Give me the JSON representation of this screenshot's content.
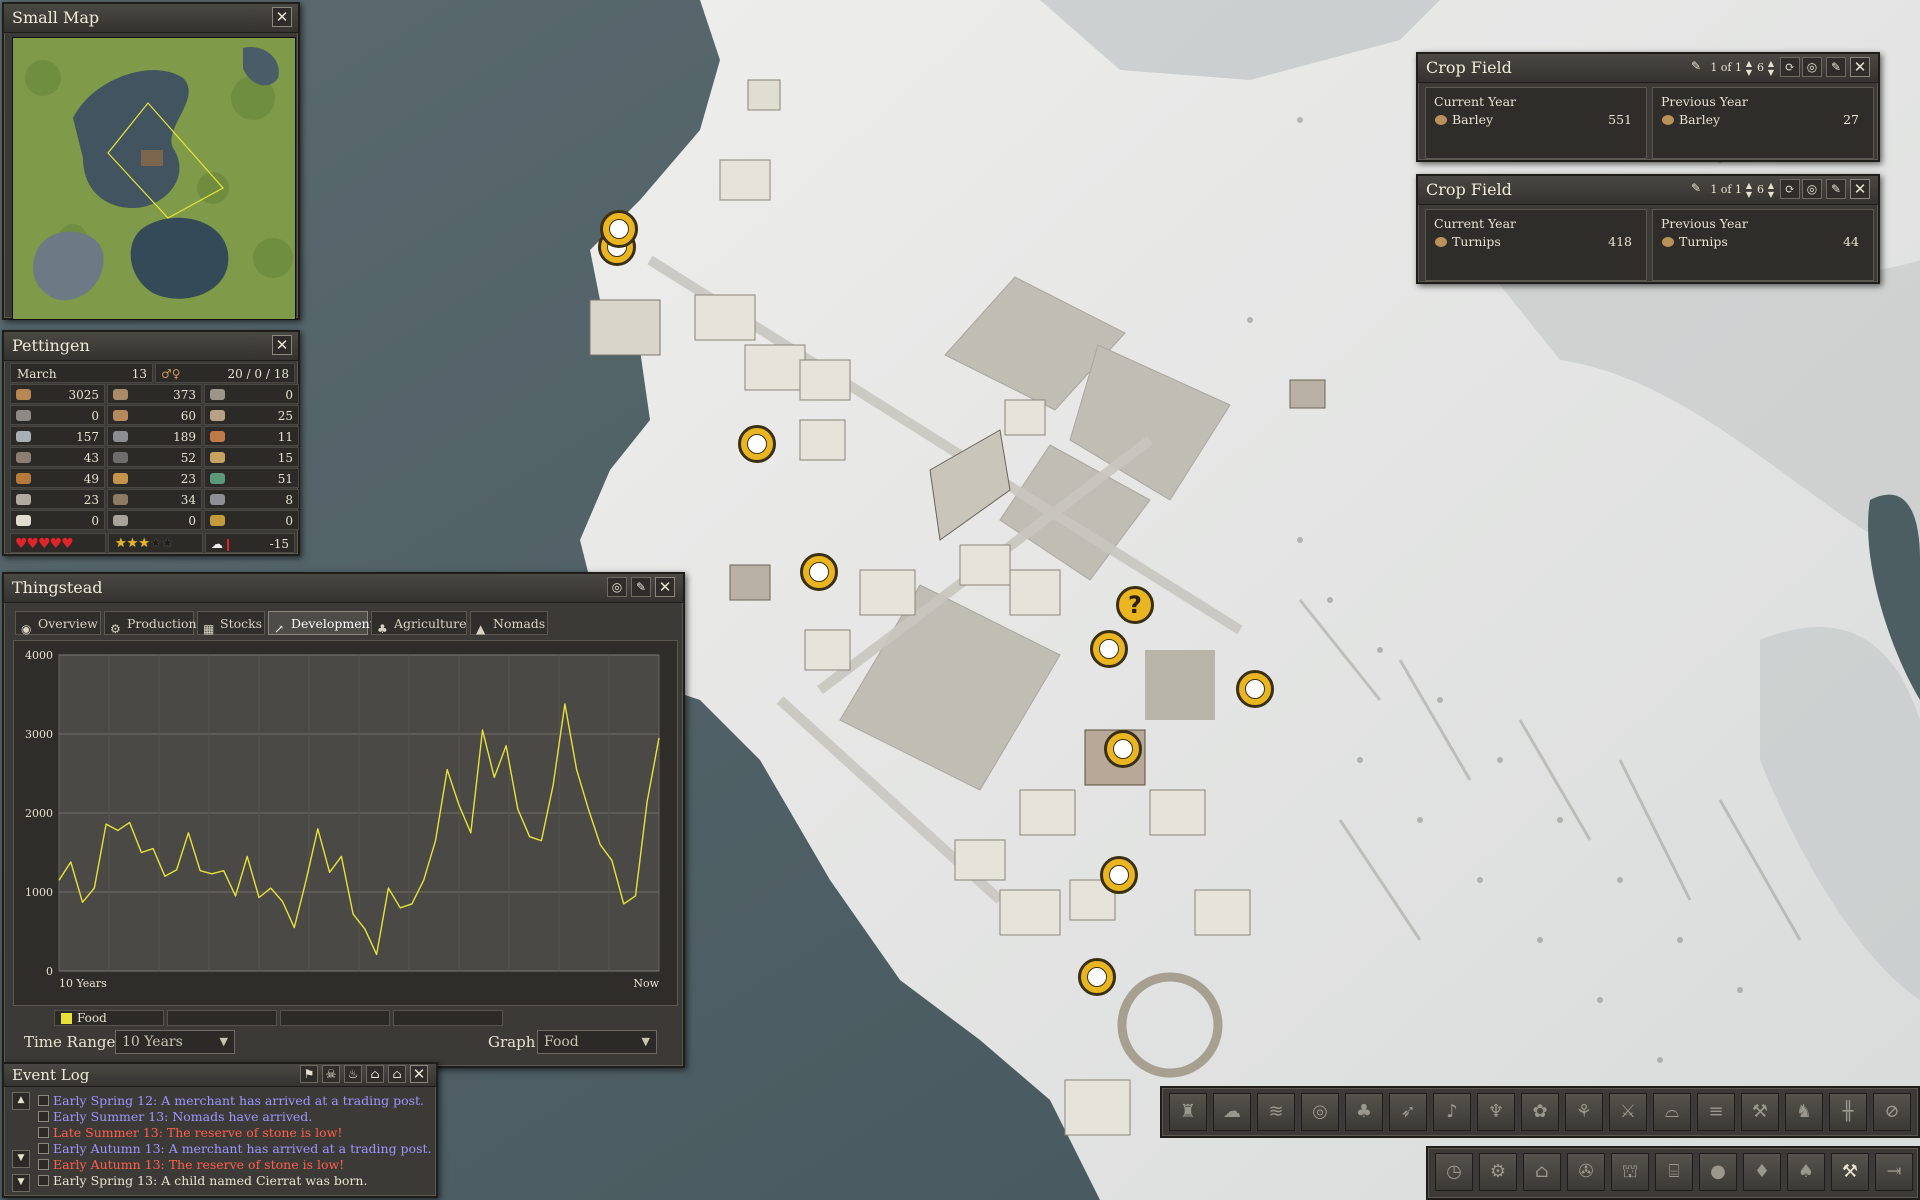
{
  "small_map": {
    "title": "Small Map"
  },
  "town": {
    "title": "Pettingen",
    "month": "March",
    "year": "13",
    "population": "20 / 0 / 18",
    "resources": [
      {
        "icon": "logs-icon",
        "value": "3025"
      },
      {
        "icon": "firewood-icon",
        "value": "373"
      },
      {
        "icon": "tool-icon",
        "value": "0"
      },
      {
        "icon": "stone-icon",
        "value": "0"
      },
      {
        "icon": "coat-icon",
        "value": "60"
      },
      {
        "icon": "pick-icon",
        "value": "25"
      },
      {
        "icon": "fish-icon",
        "value": "157"
      },
      {
        "icon": "hide-icon",
        "value": "189"
      },
      {
        "icon": "meat-icon",
        "value": "11"
      },
      {
        "icon": "iron-icon",
        "value": "43"
      },
      {
        "icon": "coal-icon",
        "value": "52"
      },
      {
        "icon": "bread-icon",
        "value": "15"
      },
      {
        "icon": "ale-icon",
        "value": "49"
      },
      {
        "icon": "pie-icon",
        "value": "23"
      },
      {
        "icon": "cloth-icon",
        "value": "51"
      },
      {
        "icon": "wool-icon",
        "value": "23"
      },
      {
        "icon": "leather-icon",
        "value": "34"
      },
      {
        "icon": "anvil-icon",
        "value": "8"
      },
      {
        "icon": "egg-icon",
        "value": "0"
      },
      {
        "icon": "cart-icon",
        "value": "0"
      },
      {
        "icon": "coin-icon",
        "value": "0"
      }
    ],
    "health_hearts": 5,
    "happiness_stars": 3,
    "happiness_max": 5,
    "temperature": "-15"
  },
  "thingstead": {
    "title": "Thingstead",
    "tabs": [
      {
        "label": "Overview",
        "icon": "eye-icon"
      },
      {
        "label": "Production",
        "icon": "gear-icon"
      },
      {
        "label": "Stocks",
        "icon": "stack-icon"
      },
      {
        "label": "Development",
        "icon": "graph-icon",
        "active": true
      },
      {
        "label": "Agriculture",
        "icon": "leaf-icon"
      },
      {
        "label": "Nomads",
        "icon": "tent-icon"
      }
    ],
    "time_range_label": "Time Range",
    "time_range_value": "10 Years",
    "graph_label": "Graph",
    "graph_value": "Food",
    "legend": [
      "Food"
    ]
  },
  "chart_data": {
    "type": "line",
    "ylim": [
      0,
      4000
    ],
    "yticks": [
      "0",
      "1000",
      "2000",
      "3000",
      "4000"
    ],
    "xlabels": [
      "10 Years",
      "Now"
    ],
    "series": [
      {
        "name": "Food",
        "color": "#e6e23a",
        "values": [
          1150,
          1380,
          870,
          1050,
          1860,
          1780,
          1880,
          1500,
          1550,
          1200,
          1280,
          1750,
          1270,
          1230,
          1270,
          950,
          1450,
          930,
          1050,
          880,
          550,
          1150,
          1800,
          1250,
          1450,
          720,
          530,
          210,
          1050,
          800,
          850,
          1150,
          1650,
          2550,
          2100,
          1750,
          3050,
          2450,
          2850,
          2050,
          1700,
          1650,
          2350,
          3380,
          2550,
          2050,
          1600,
          1400,
          850,
          950,
          2150,
          2950
        ]
      }
    ]
  },
  "crop_fields": [
    {
      "title": "Crop Field",
      "pager": "1 of 1",
      "count": "6",
      "current": {
        "label": "Current Year",
        "crop": "Barley",
        "value": "551"
      },
      "previous": {
        "label": "Previous Year",
        "crop": "Barley",
        "value": "27"
      }
    },
    {
      "title": "Crop Field",
      "pager": "1 of 1",
      "count": "6",
      "current": {
        "label": "Current Year",
        "crop": "Turnips",
        "value": "418"
      },
      "previous": {
        "label": "Previous Year",
        "crop": "Turnips",
        "value": "44"
      }
    }
  ],
  "event_log": {
    "title": "Event Log",
    "entries": [
      {
        "text": "Early Spring 12: A merchant has arrived at a trading post.",
        "color": "#9f95ff"
      },
      {
        "text": "Early Summer 13: Nomads have arrived.",
        "color": "#9f95ff"
      },
      {
        "text": "Late Summer 13: The reserve of stone is low!",
        "color": "#ff5f4e"
      },
      {
        "text": "Early Autumn 13: A merchant has arrived at a trading post.",
        "color": "#9f95ff"
      },
      {
        "text": "Early Autumn 13: The reserve of stone is low!",
        "color": "#ff5f4e"
      },
      {
        "text": "Early Spring 13: A child named Cierrat was born.",
        "color": "#e8e2d0"
      }
    ]
  },
  "build_toolbar": [
    "well-icon",
    "boulder-icon",
    "bridge-icon",
    "target-icon",
    "orchard-icon",
    "bow-icon",
    "horn-icon",
    "lobster-icon",
    "berry-icon",
    "wheat-icon",
    "crossed-tools-icon",
    "pot-icon",
    "field-icon",
    "hammer-icon",
    "chair-icon",
    "fence-icon",
    "cancel-icon"
  ],
  "main_toolbar": [
    "clock-icon",
    "gears-icon",
    "house-icon",
    "wheel-icon",
    "barn-icon",
    "temple-icon",
    "apple-icon",
    "drop-icon",
    "tree-icon",
    "build-icon",
    "exit-icon"
  ]
}
